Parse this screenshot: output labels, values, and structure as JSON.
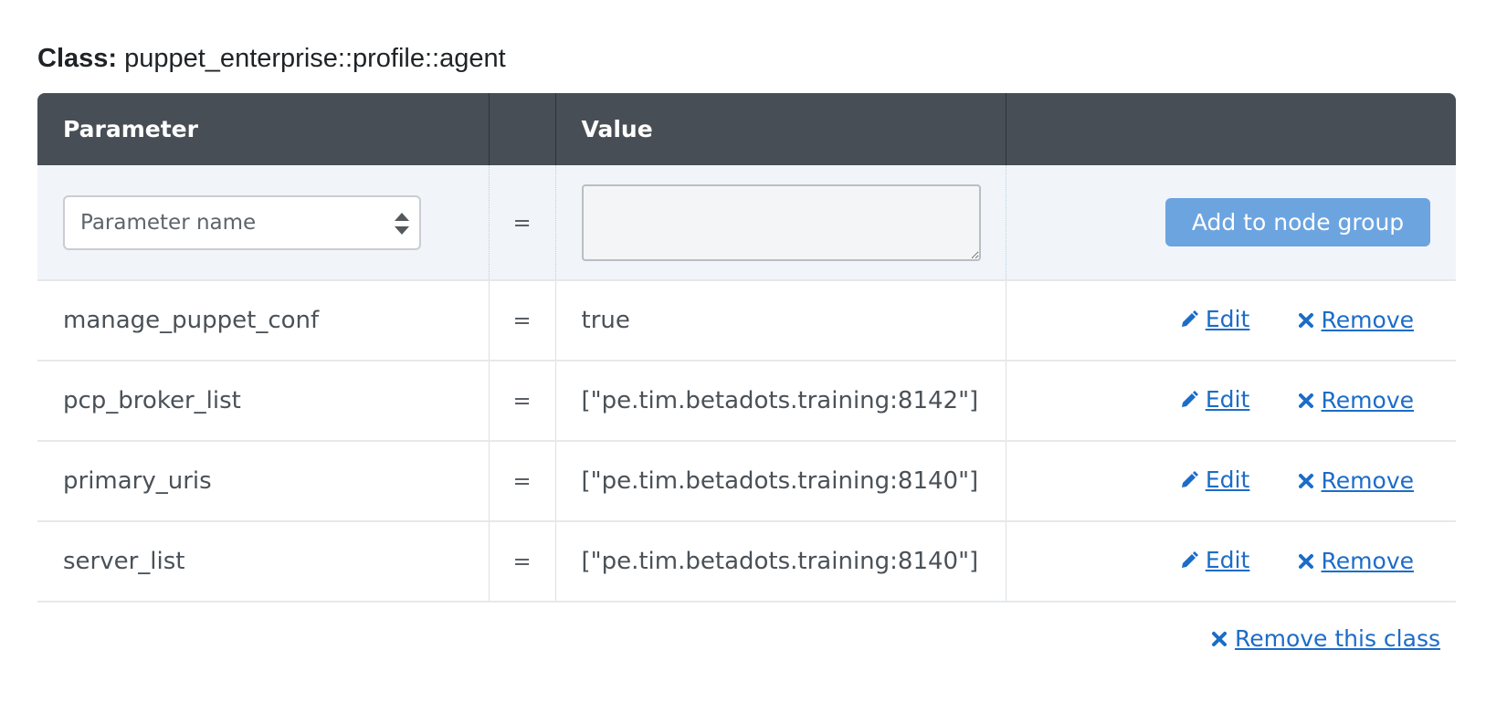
{
  "class_section": {
    "label": "Class:",
    "name": "puppet_enterprise::profile::agent"
  },
  "table": {
    "headers": {
      "parameter": "Parameter",
      "equals": "",
      "value": "Value",
      "actions": ""
    },
    "new_row": {
      "param_placeholder": "Parameter name",
      "equals": "=",
      "value": "",
      "add_button": "Add to node group"
    },
    "rows": [
      {
        "name": "manage_puppet_conf",
        "equals": "=",
        "value": "true",
        "edit": "Edit",
        "remove": "Remove"
      },
      {
        "name": "pcp_broker_list",
        "equals": "=",
        "value": "[\"pe.tim.betadots.training:8142\"]",
        "edit": "Edit",
        "remove": "Remove"
      },
      {
        "name": "primary_uris",
        "equals": "=",
        "value": "[\"pe.tim.betadots.training:8140\"]",
        "edit": "Edit",
        "remove": "Remove"
      },
      {
        "name": "server_list",
        "equals": "=",
        "value": "[\"pe.tim.betadots.training:8140\"]",
        "edit": "Edit",
        "remove": "Remove"
      }
    ]
  },
  "remove_class": "Remove this class",
  "icons": {
    "edit": "pencil-icon",
    "remove": "close-icon",
    "select": "sort-arrows-icon"
  },
  "colors": {
    "header_bg": "#484e55",
    "link": "#1c6cc8",
    "button_bg": "#6ca4e0",
    "new_row_bg": "#f1f5f9"
  }
}
